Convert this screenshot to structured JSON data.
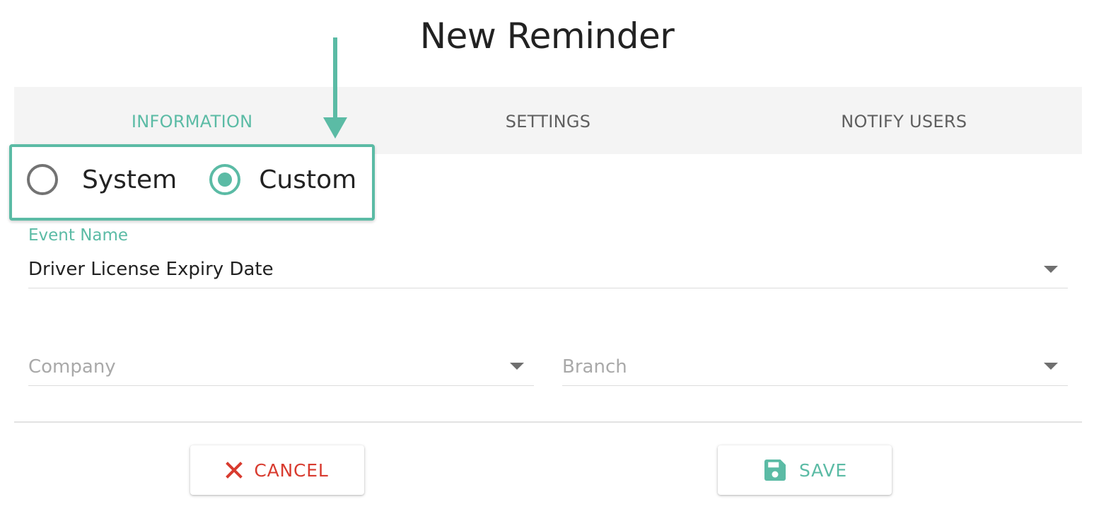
{
  "dialog": {
    "title": "New Reminder"
  },
  "tabs": [
    {
      "label": "INFORMATION",
      "active": true
    },
    {
      "label": "SETTINGS",
      "active": false
    },
    {
      "label": "NOTIFY USERS",
      "active": false
    }
  ],
  "reminder_type": {
    "options": [
      {
        "label": "System",
        "selected": false
      },
      {
        "label": "Custom",
        "selected": true
      }
    ]
  },
  "fields": {
    "event_name": {
      "label": "Event Name",
      "value": "Driver License Expiry Date"
    },
    "company": {
      "placeholder": "Company"
    },
    "branch": {
      "placeholder": "Branch"
    }
  },
  "buttons": {
    "cancel_label": "CANCEL",
    "save_label": "SAVE"
  },
  "icons": {
    "cancel": "close-icon",
    "save": "save-icon",
    "dropdown": "caret-down-icon"
  },
  "colors": {
    "accent": "#5bbba5",
    "danger": "#d83b2f",
    "text": "#222222",
    "tab_bar": "#f4f4f4"
  }
}
